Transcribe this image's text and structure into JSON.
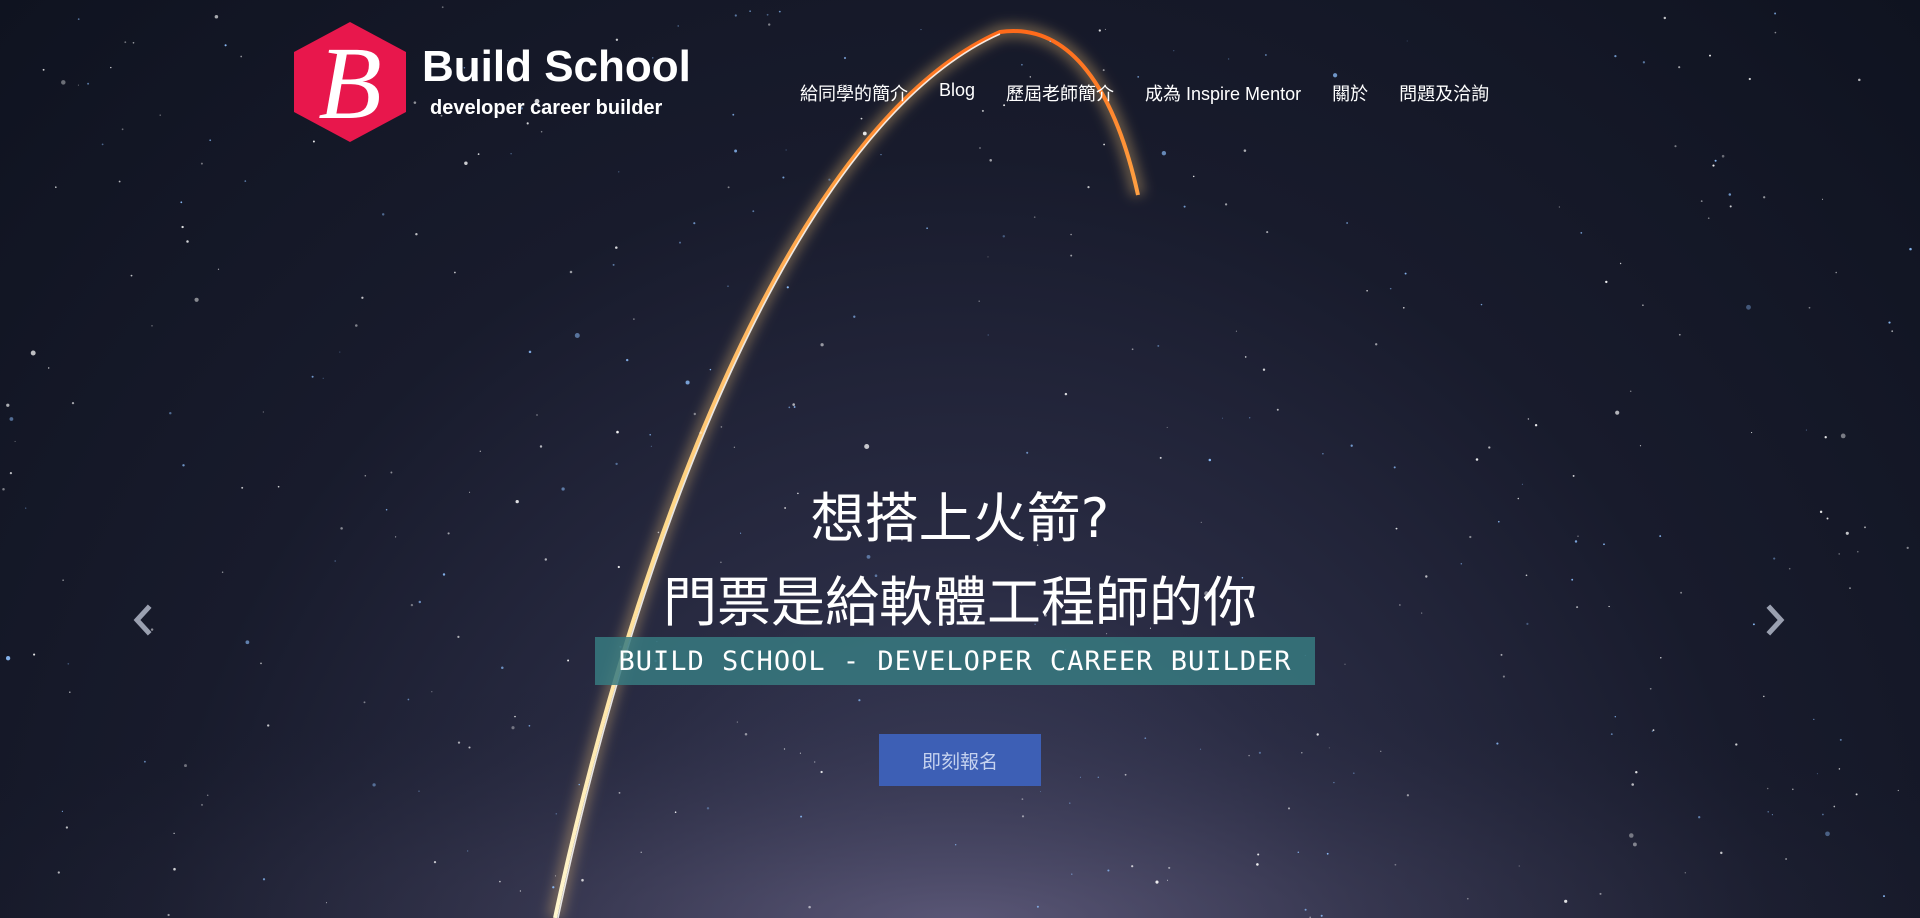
{
  "brand": {
    "logo_letter": "B",
    "title": "Build School",
    "subtitle": "developer career builder",
    "accent_color": "#e8174c"
  },
  "nav": {
    "items": [
      {
        "label": "給同學的簡介"
      },
      {
        "label": "Blog"
      },
      {
        "label": "歷屆老師簡介"
      },
      {
        "label": "成為 Inspire Mentor"
      },
      {
        "label": "關於"
      },
      {
        "label": "問題及洽詢"
      }
    ]
  },
  "hero": {
    "headline_line1": "想搭上火箭?",
    "headline_line2": "門票是給軟體工程師的你",
    "tagline": "BUILD SCHOOL - DEVELOPER CAREER BUILDER",
    "cta_label": "即刻報名",
    "cta_color": "#3d5fb5",
    "tagline_bg_color": "#377a80"
  },
  "carousel": {
    "prev_icon": "chevron-left-icon",
    "next_icon": "chevron-right-icon"
  }
}
